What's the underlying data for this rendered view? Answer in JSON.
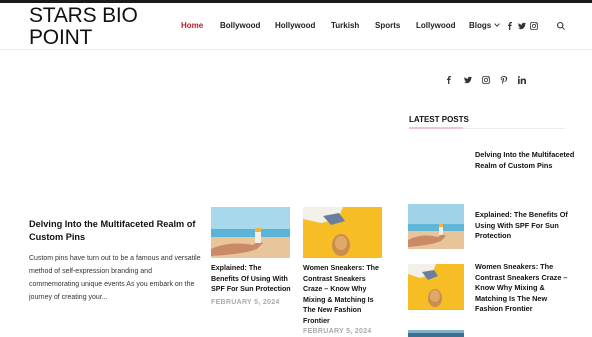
{
  "site": {
    "logo_line1": "STARS BIO",
    "logo_line2": "POINT"
  },
  "nav": {
    "items": [
      "Home",
      "Bollywood",
      "Hollywood",
      "Turkish",
      "Sports",
      "Lollywood",
      "Blogs"
    ]
  },
  "header_social": [
    "facebook-icon",
    "twitter-icon",
    "instagram-icon"
  ],
  "sidebar": {
    "social": [
      "facebook-icon",
      "twitter-icon",
      "instagram-icon",
      "pinterest-icon",
      "linkedin-icon"
    ],
    "latest_title": "LATEST POSTS",
    "posts": [
      {
        "title": "Delving Into the Multifaceted Realm of Custom Pins"
      },
      {
        "title": "Explained: The Benefits Of Using With SPF For Sun Protection"
      },
      {
        "title": "Women Sneakers: The Contrast Sneakers Craze – Know Why Mixing & Matching Is The New Fashion Frontier"
      }
    ]
  },
  "featured": {
    "title": "Delving Into the Multifaceted Realm of Custom Pins",
    "excerpt": "Custom pins have turn out to be a famous and versatile method of self-expression branding and commemorating unique events As you embark on the journey of creating your..."
  },
  "cards": [
    {
      "title": "Explained: The Benefits Of Using With SPF For Sun Protection",
      "date": "FEBRUARY 5, 2024"
    },
    {
      "title": "Women Sneakers: The Contrast Sneakers Craze – Know Why Mixing & Matching Is The New Fashion Frontier",
      "date": "FEBRUARY 5, 2024"
    }
  ],
  "colors": {
    "accent": "#b81c25",
    "date": "#aaaaaa",
    "underline": "#f0c6cc"
  }
}
